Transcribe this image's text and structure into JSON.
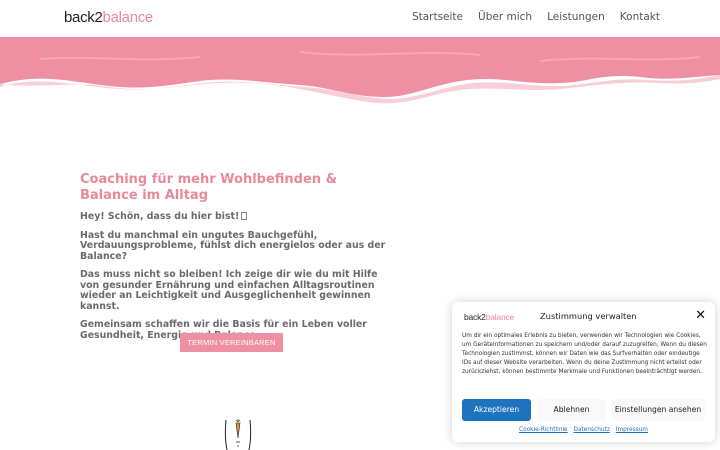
{
  "brand": {
    "logo_part1": "back2",
    "logo_part2": "balance",
    "accent": "#e8899c"
  },
  "nav": {
    "items": [
      {
        "label": "Startseite"
      },
      {
        "label": "Über mich"
      },
      {
        "label": "Leistungen"
      },
      {
        "label": "Kontakt"
      }
    ]
  },
  "main": {
    "title": "Coaching für mehr Wohlbefinden & Balance im Alltag",
    "greeting": "Hey! Schön, dass du hier bist!",
    "paragraph1": "Hast du manchmal ein ungutes Bauchgefühl, Verdauungsprobleme, fühlst dich energielos oder aus der Balance?",
    "paragraph2": "Das muss nicht so bleiben! Ich zeige dir wie du mit Hilfe von gesunder Ernährung und einfachen Alltagsroutinen wieder an Leichtigkeit und Ausgeglichenheit gewinnen kannst.",
    "paragraph3": "Gemeinsam schaffen wir die Basis für ein Leben voller Gesundheit, Energie und Balance.",
    "cta_label": "TERMIN VEREINBAREN"
  },
  "consent": {
    "title": "Zustimmung verwalten",
    "close_icon": "close-icon",
    "text": "Um dir ein optimales Erlebnis zu bieten, verwenden wir Technologien wie Cookies, um Geräteinformationen zu speichern und/oder darauf zuzugreifen. Wenn du diesen Technologien zustimmst, können wir Daten wie das Surfverhalten oder eindeutige IDs auf dieser Website verarbeiten. Wenn du deine Zustimmung nicht erteilst oder zurückziehst, können bestimmte Merkmale und Funktionen beeinträchtigt werden.",
    "accept_label": "Akzeptieren",
    "deny_label": "Ablehnen",
    "settings_label": "Einstellungen ansehen",
    "links": [
      "Cookie-Richtlinie",
      "Datenschutz",
      "Impressum"
    ],
    "accept_color": "#1e73be"
  }
}
